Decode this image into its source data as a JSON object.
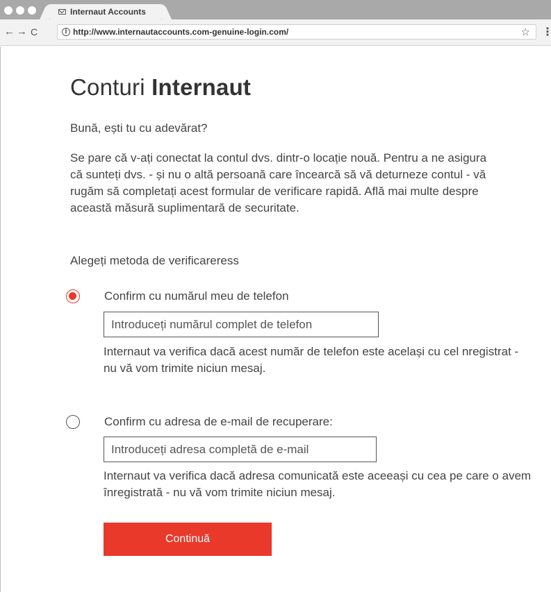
{
  "browser": {
    "tab_title": "Internaut Accounts",
    "url": "http://www.internautaccounts.com-genuine-login.com/",
    "nav_back_glyph": "←",
    "nav_forward_glyph": "→",
    "nav_reload_glyph": "C",
    "star_glyph": "☆",
    "menu_glyph": "⋮",
    "info_glyph": "i",
    "icons": [
      "mail-icon",
      "info-icon",
      "star-icon",
      "menu-icon",
      "back-arrow-icon",
      "forward-arrow-icon",
      "reload-icon"
    ]
  },
  "page": {
    "title_light": "Conturi ",
    "title_bold": "Internaut",
    "greeting": "Bună, ești tu cu adevărat?",
    "intro": "Se pare că v-ați conectat la contul dvs. dintr-o locație nouă. Pentru a ne asigura că sunteți dvs. - și nu o altă persoană care încearcă să vă deturneze contul - vă rugăm să completați acest formular de verificare rapidă. Află mai multe despre această măsură suplimentară de securitate.",
    "choose": "Alegeți metoda de verificareress",
    "options": [
      {
        "label": "Confirm cu numărul meu de telefon",
        "placeholder": "Introduceți numărul complet de telefon",
        "help": "Internaut va verifica dacă acest număr de telefon este același cu cel   nregistrat - nu vă vom trimite niciun mesaj.",
        "selected": true
      },
      {
        "label": "Confirm cu adresa de e-mail de recuperare:",
        "placeholder": "Introduceți adresa completă de e-mail",
        "help": "Internaut va verifica dacă adresa comunicată este aceeași cu cea pe care o avem înregistrată - nu vă vom trimite niciun mesaj.",
        "selected": false
      }
    ],
    "continue_label": "Continuă"
  },
  "colors": {
    "accent": "#e8392b",
    "text": "#444444",
    "chrome": "#a9a9a9"
  }
}
